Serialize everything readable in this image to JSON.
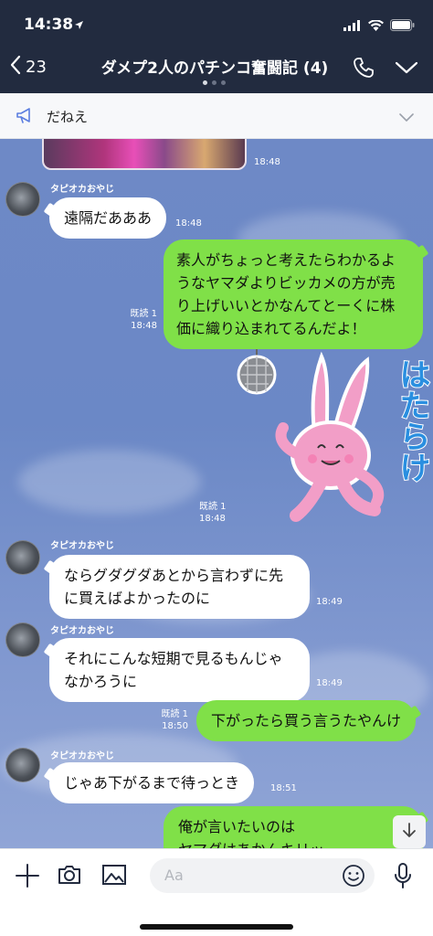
{
  "status_bar": {
    "time": "14:38"
  },
  "header": {
    "back_count": "23",
    "title": "ダメプ2人のパチンコ奮闘記 (4)"
  },
  "announcement": {
    "text": "だねえ"
  },
  "messages": [
    {
      "id": "m0",
      "type": "image",
      "side": "left",
      "time": "18:48"
    },
    {
      "id": "m1",
      "type": "text",
      "side": "left",
      "sender": "タピオカおやじ",
      "lines": [
        "遠隔だあああ"
      ],
      "time": "18:48"
    },
    {
      "id": "m2",
      "type": "text",
      "side": "right",
      "lines": [
        "素人がちょっと考えたらわかるよ",
        "うなヤマダよりビッカメの方が売",
        "り上げいいとかなんてとーくに株",
        "価に織り込まれてるんだよ！"
      ],
      "read": "既読 1",
      "time": "18:48"
    },
    {
      "id": "m3",
      "type": "sticker",
      "side": "right",
      "sticker_text": "はたらけ",
      "read": "既読 1",
      "time": "18:48"
    },
    {
      "id": "m4",
      "type": "text",
      "side": "left",
      "sender": "タピオカおやじ",
      "lines": [
        "ならグダグダあとから言わずに先",
        "に買えばよかったのに"
      ],
      "time": "18:49"
    },
    {
      "id": "m5",
      "type": "text",
      "side": "left",
      "sender": "タピオカおやじ",
      "lines": [
        "それにこんな短期で見るもんじゃ",
        "なかろうに"
      ],
      "time": "18:49"
    },
    {
      "id": "m6",
      "type": "text",
      "side": "right",
      "lines": [
        "下がったら買う言うたやんけ"
      ],
      "read": "既読 1",
      "time": "18:50"
    },
    {
      "id": "m7",
      "type": "text",
      "side": "left",
      "sender": "タピオカおやじ",
      "lines": [
        "じゃあ下がるまで待っとき"
      ],
      "time": "18:51"
    },
    {
      "id": "m8",
      "type": "text",
      "side": "right",
      "lines": [
        "俺が言いたいのは",
        "ヤマダはあかんキリッ"
      ]
    }
  ],
  "input": {
    "placeholder": "Aa"
  },
  "colors": {
    "header": "#222b3f",
    "chat_bg": "#6e89c6",
    "my_bubble": "#80e048",
    "their_bubble": "#ffffff"
  },
  "icons": [
    "back-chevron-icon",
    "phone-icon",
    "chevron-down-icon",
    "megaphone-icon",
    "plus-icon",
    "camera-icon",
    "image-icon",
    "emoji-icon",
    "microphone-icon",
    "arrow-down-icon"
  ]
}
